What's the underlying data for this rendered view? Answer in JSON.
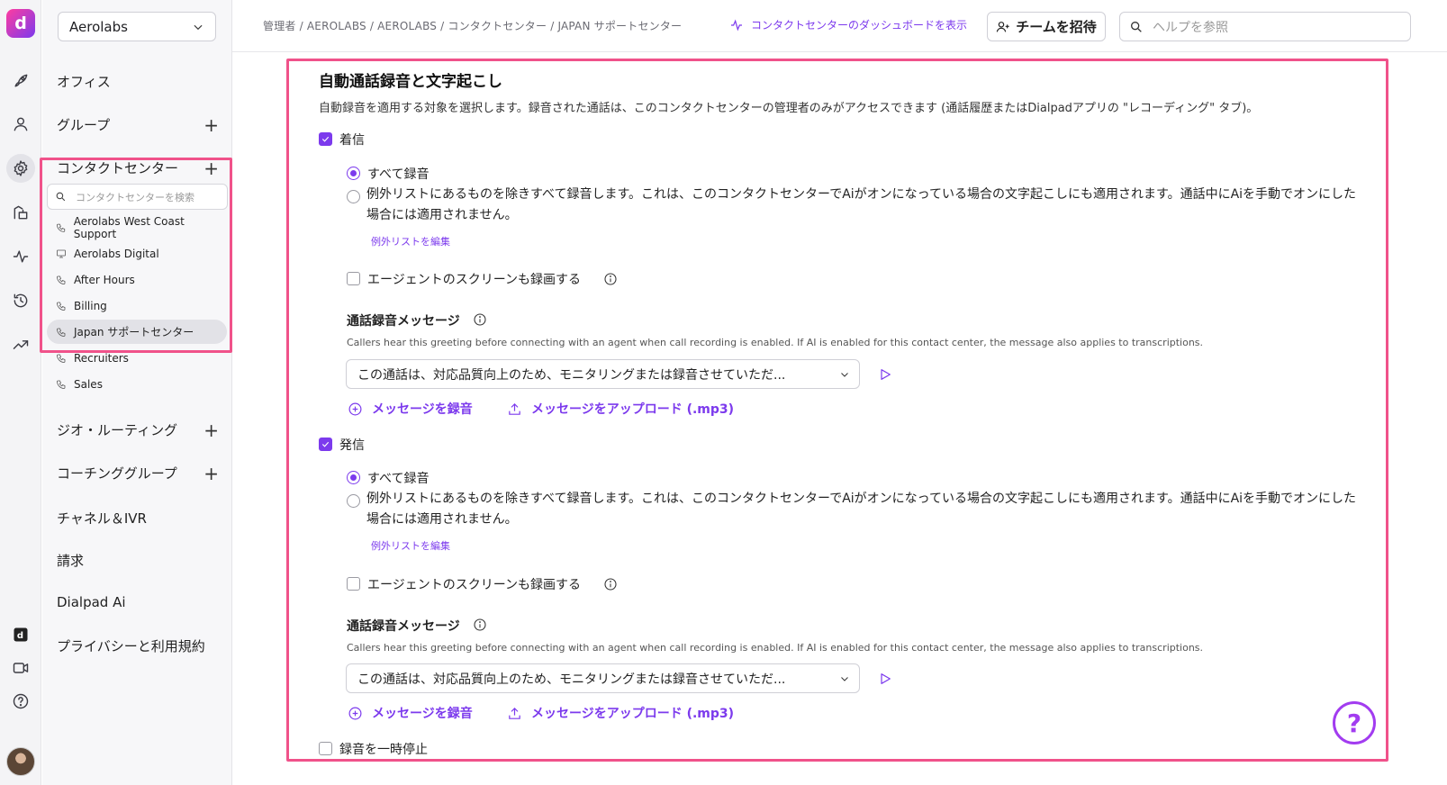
{
  "rail": {
    "brand_letter": "d",
    "items": [
      {
        "name": "rocket-icon"
      },
      {
        "name": "user-icon"
      },
      {
        "name": "gear-icon"
      },
      {
        "name": "contact-center-icon"
      },
      {
        "name": "activity-icon"
      },
      {
        "name": "history-icon"
      },
      {
        "name": "trending-icon"
      }
    ],
    "bottom": [
      {
        "name": "dialpad-app-icon"
      },
      {
        "name": "video-icon"
      },
      {
        "name": "help-icon"
      }
    ]
  },
  "sidebar": {
    "org_name": "Aerolabs",
    "nav": {
      "office": "オフィス",
      "groups": "グループ",
      "contact_center": "コンタクトセンター",
      "geo_routing": "ジオ・ルーティング",
      "coaching_groups": "コーチンググループ",
      "channels_ivr": "チャネル＆IVR",
      "billing": "請求",
      "dialpad_ai": "Dialpad Ai",
      "privacy": "プライバシーと利用規約"
    },
    "cc_search_placeholder": "コンタクトセンターを検索",
    "contact_centers": [
      {
        "label": "Aerolabs West Coast Support",
        "icon": "phone-icon"
      },
      {
        "label": "Aerolabs Digital",
        "icon": "monitor-icon"
      },
      {
        "label": "After Hours",
        "icon": "phone-icon"
      },
      {
        "label": "Billing",
        "icon": "phone-icon"
      },
      {
        "label": "Japan サポートセンター",
        "icon": "phone-icon"
      },
      {
        "label": "Recruiters",
        "icon": "phone-icon"
      },
      {
        "label": "Sales",
        "icon": "phone-icon"
      }
    ]
  },
  "topbar": {
    "breadcrumb": "管理者 / AEROLABS / AEROLABS / コンタクトセンター / JAPAN サポートセンター",
    "dashboard_link": "コンタクトセンターのダッシュボードを表示",
    "invite_label": "チームを招待",
    "help_placeholder": "ヘルプを参照"
  },
  "section": {
    "title": "自動通話録音と文字起こし",
    "description": "自動録音を適用する対象を選択します。録音された通話は、このコンタクトセンターの管理者のみがアクセスできます (通話履歴またはDialpadアプリの \"レコーディング\" タブ)。",
    "inbound": {
      "label": "着信",
      "checked": true,
      "record_all": "すべて録音",
      "record_except": "例外リストにあるものを除きすべて録音します。これは、このコンタクトセンターでAiがオンになっている場合の文字起こしにも適用されます。通話中にAiを手動でオンにした場合には適用されません。",
      "edit_exceptions": "例外リストを編集",
      "screen_record": "エージェントのスクリーンも録画する",
      "message_title": "通話録音メッセージ",
      "message_desc": "Callers hear this greeting before connecting with an agent when call recording is enabled. If AI is enabled for this contact center, the message also applies to transcriptions.",
      "message_value": "この通話は、対応品質向上のため、モニタリングまたは録音させていただ...",
      "record_message": "メッセージを録音",
      "upload_message": "メッセージをアップロード (.mp3)"
    },
    "outbound": {
      "label": "発信",
      "checked": true,
      "record_all": "すべて録音",
      "record_except": "例外リストにあるものを除きすべて録音します。これは、このコンタクトセンターでAiがオンになっている場合の文字起こしにも適用されます。通話中にAiを手動でオンにした場合には適用されません。",
      "edit_exceptions": "例外リストを編集",
      "screen_record": "エージェントのスクリーンも録画する",
      "message_title": "通話録音メッセージ",
      "message_desc": "Callers hear this greeting before connecting with an agent when call recording is enabled. If AI is enabled for this contact center, the message also applies to transcriptions.",
      "message_value": "この通話は、対応品質向上のため、モニタリングまたは録音させていただ...",
      "record_message": "メッセージを録音",
      "upload_message": "メッセージをアップロード (.mp3)"
    },
    "pause_recording": "録音を一時停止"
  },
  "help_fab": "?",
  "colors": {
    "accent": "#7c3aed",
    "highlight": "#f0528a"
  }
}
